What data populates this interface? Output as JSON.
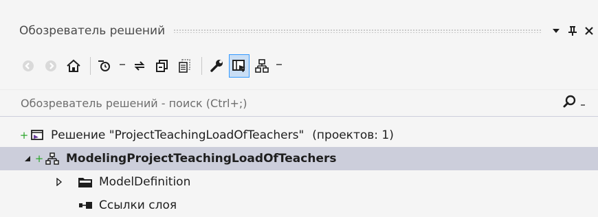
{
  "window": {
    "title": "Обозреватель решений",
    "buttons": [
      {
        "name": "dropdown-arrow-icon",
        "glyph": "▼"
      },
      {
        "name": "pin-icon",
        "glyph": "Ⴔ"
      },
      {
        "name": "close-icon",
        "glyph": "✕"
      }
    ]
  },
  "toolbar": {
    "items": [
      "back-icon",
      "forward-icon",
      "home-icon",
      "pending-changes-filter-icon",
      "sync-with-active-document-icon",
      "collapse-all-icon",
      "show-all-files-icon",
      "properties-icon",
      "preview-selected-items-icon",
      "class-view-icon"
    ],
    "active_item": "preview-selected-items-icon"
  },
  "search": {
    "placeholder": "Обозреватель решений - поиск (Ctrl+;)"
  },
  "tree": {
    "solution": {
      "label": "Решение \"ProjectTeachingLoadOfTeachers\"",
      "count_label": "(проектов: 1)",
      "icon": "solution-icon"
    },
    "project": {
      "label": "ModelingProjectTeachingLoadOfTeachers",
      "icon": "modeling-project-icon",
      "selected": true,
      "expanded": true
    },
    "children": [
      {
        "label": "ModelDefinition",
        "icon": "folder-icon",
        "expandable": true
      },
      {
        "label": "Ссылки слоя",
        "icon": "layer-references-icon",
        "expandable": false
      }
    ]
  },
  "colors": {
    "background": "#f5f5f5",
    "selected_row": "#cccedb",
    "active_button": "#c9def5",
    "active_border": "#3399ff",
    "plus_green": "#2aa52a"
  }
}
